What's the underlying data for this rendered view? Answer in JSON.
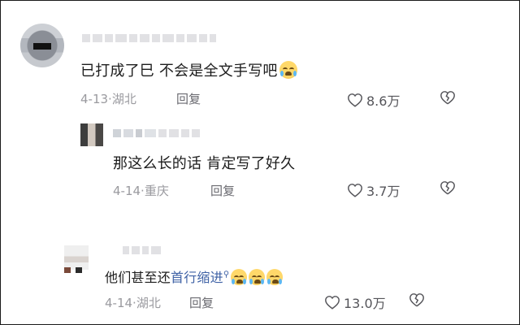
{
  "comments": [
    {
      "text": "已打成了巳 不会是全文手写吧",
      "date": "4-13",
      "location": "湖北",
      "reply_label": "回复",
      "likes": "8.6万"
    },
    {
      "text": "那这么长的话 肯定写了好久",
      "date": "4-14",
      "location": "重庆",
      "reply_label": "回复",
      "likes": "3.7万"
    },
    {
      "text_prefix": "他们甚至还",
      "link_text": "首行缩进",
      "date": "4-14",
      "location": "湖北",
      "reply_label": "回复",
      "likes": "13.0万"
    }
  ],
  "separator": "·",
  "icons": {
    "like": "heart-icon",
    "dislike": "broken-heart-icon",
    "search": "search-icon",
    "emoji": "crying-face-emoji"
  },
  "colors": {
    "text": "#1c1c1c",
    "meta": "#9a9a9f",
    "link": "#3f62a6",
    "emoji": "#ffd86a"
  }
}
